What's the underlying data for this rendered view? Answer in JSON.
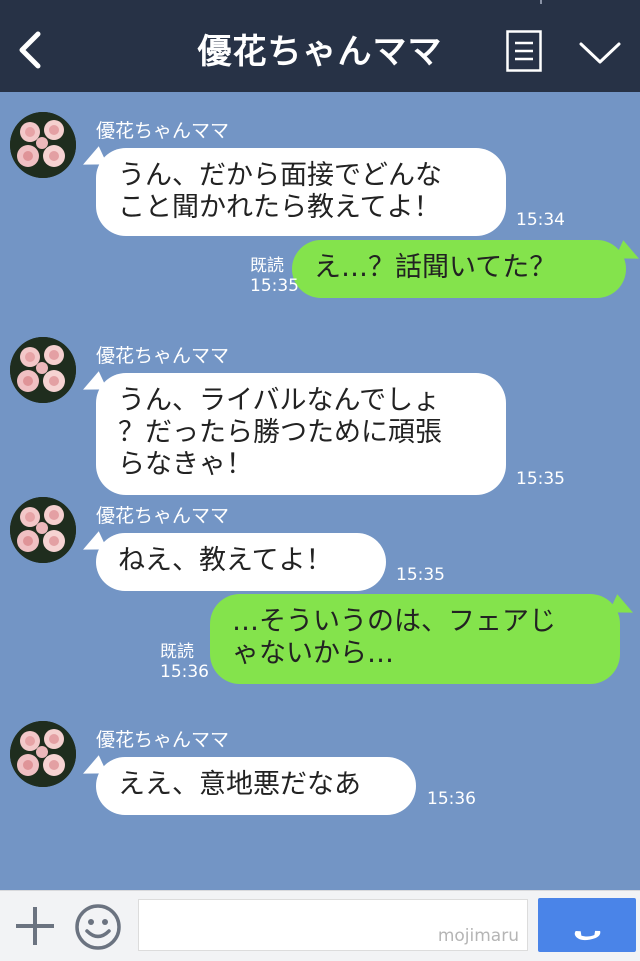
{
  "header": {
    "title": "優花ちゃんママ",
    "back_icon": "chevron-left-icon",
    "menu_icon": "list-menu-icon",
    "collapse_icon": "chevron-down-icon"
  },
  "messages": [
    {
      "side": "left",
      "sender": "優花ちゃんママ",
      "lines": [
        "うん、だから面接でどんな",
        "こと聞かれたら教えてよ！"
      ],
      "time": "15:34"
    },
    {
      "side": "right",
      "read": "既読",
      "time": "15:35",
      "lines": [
        "え…？話聞いてた？"
      ]
    },
    {
      "side": "left",
      "sender": "優花ちゃんママ",
      "lines": [
        "うん、ライバルなんでしょ",
        "？だったら勝つために頑張",
        "らなきゃ！"
      ],
      "time": "15:35"
    },
    {
      "side": "left",
      "sender": "優花ちゃんママ",
      "lines": [
        "ねえ、教えてよ！"
      ],
      "time": "15:35"
    },
    {
      "side": "right",
      "read": "既読",
      "time": "15:36",
      "lines": [
        "…そういうのは、フェアじ",
        "ゃないから…"
      ]
    },
    {
      "side": "left",
      "sender": "優花ちゃんママ",
      "lines": [
        "ええ、意地悪だなあ"
      ],
      "time": "15:36"
    }
  ],
  "footer": {
    "plus_icon": "plus-icon",
    "sticker_icon": "smiley-icon",
    "input_value": "",
    "watermark": "mojimaru",
    "call_icon": "phone-icon"
  },
  "colors": {
    "header_bg": "#273246",
    "chat_bg": "#7395c5",
    "left_bubble": "#ffffff",
    "right_bubble": "#84e34c",
    "send_button": "#4a84e8"
  }
}
